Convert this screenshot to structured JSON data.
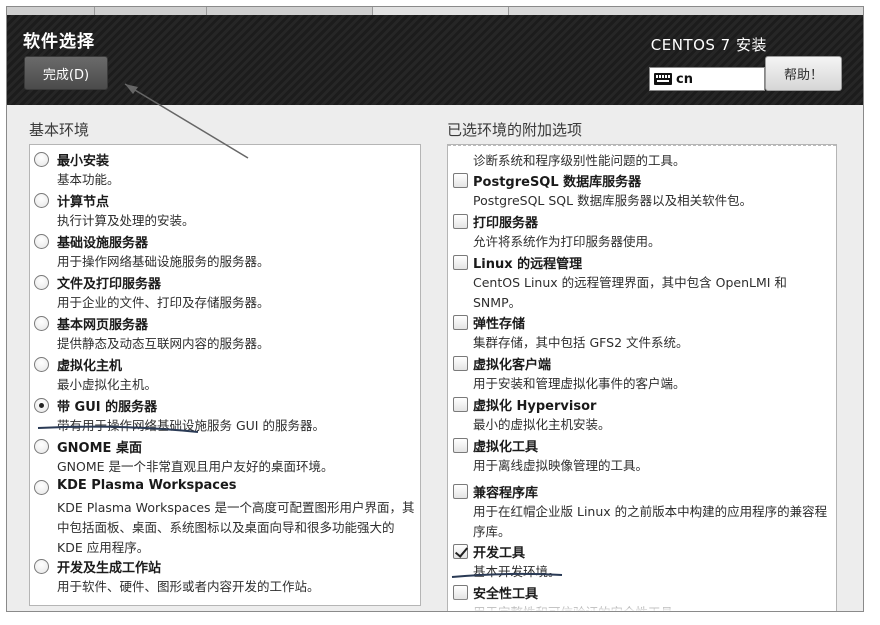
{
  "header": {
    "title": "软件选择",
    "done_label": "完成(D)",
    "product": "CENTOS 7 安装",
    "keyboard_layout": "cn",
    "help_label": "帮助！",
    "keyboard_icon": "keyboard-icon"
  },
  "base_env": {
    "title": "基本环境",
    "items": [
      {
        "name": "最小安装",
        "desc": "基本功能。",
        "selected": false
      },
      {
        "name": "计算节点",
        "desc": "执行计算及处理的安装。",
        "selected": false
      },
      {
        "name": "基础设施服务器",
        "desc": "用于操作网络基础设施服务的服务器。",
        "selected": false
      },
      {
        "name": "文件及打印服务器",
        "desc": "用于企业的文件、打印及存储服务器。",
        "selected": false
      },
      {
        "name": "基本网页服务器",
        "desc": "提供静态及动态互联网内容的服务器。",
        "selected": false
      },
      {
        "name": "虚拟化主机",
        "desc": "最小虚拟化主机。",
        "selected": false
      },
      {
        "name": "带 GUI 的服务器",
        "desc": "带有用于操作网络基础设施服务 GUI 的服务器。",
        "selected": true
      },
      {
        "name": "GNOME 桌面",
        "desc": "GNOME 是一个非常直观且用户友好的桌面环境。",
        "selected": false
      },
      {
        "name": "KDE Plasma Workspaces",
        "desc": "KDE Plasma Workspaces 是一个高度可配置图形用户界面，其中包括面板、桌面、系统图标以及桌面向导和很多功能强大的 KDE 应用程序。",
        "selected": false
      },
      {
        "name": "开发及生成工作站",
        "desc": "用于软件、硬件、图形或者内容开发的工作站。",
        "selected": false
      }
    ]
  },
  "addons": {
    "title": "已选环境的附加选项",
    "top_partial_desc": "诊断系统和程序级别性能问题的工具。",
    "items": [
      {
        "name": "PostgreSQL 数据库服务器",
        "desc": "PostgreSQL SQL 数据库服务器以及相关软件包。",
        "checked": false
      },
      {
        "name": "打印服务器",
        "desc": "允许将系统作为打印服务器使用。",
        "checked": false
      },
      {
        "name": "Linux 的远程管理",
        "desc": "CentOS Linux 的远程管理界面，其中包含 OpenLMI 和 SNMP。",
        "checked": false
      },
      {
        "name": "弹性存储",
        "desc": "集群存储，其中包括 GFS2 文件系统。",
        "checked": false
      },
      {
        "name": "虚拟化客户端",
        "desc": "用于安装和管理虚拟化事件的客户端。",
        "checked": false
      },
      {
        "name": "虚拟化 Hypervisor",
        "desc": "最小的虚拟化主机安装。",
        "checked": false
      },
      {
        "name": "虚拟化工具",
        "desc": "用于离线虚拟映像管理的工具。",
        "checked": false
      },
      {
        "name": "兼容程序库",
        "desc": "用于在红帽企业版 Linux 的之前版本中构建的应用程序的兼容程序库。",
        "checked": false
      },
      {
        "name": "开发工具",
        "desc": "基本开发环境。",
        "checked": true
      },
      {
        "name": "安全性工具",
        "desc": "用于完整性和可信验证的安全性工具。",
        "checked": false
      }
    ]
  }
}
